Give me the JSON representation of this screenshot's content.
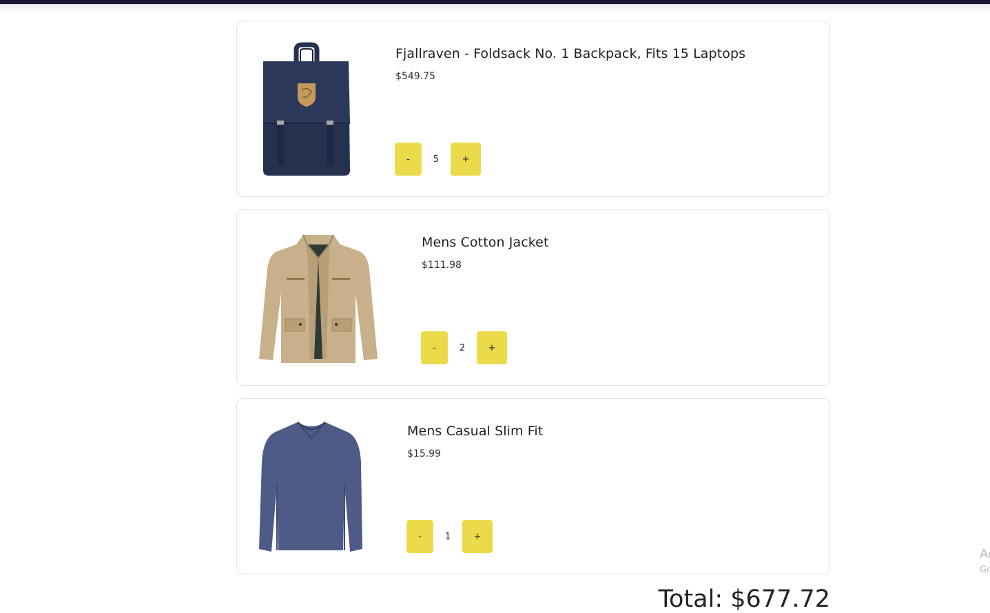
{
  "cart": {
    "items": [
      {
        "title": "Fjallraven - Foldsack No. 1 Backpack, Fits 15 Laptops",
        "price": "$549.75",
        "quantity": "5",
        "image_icon": "backpack-image",
        "image_color": "#26314f"
      },
      {
        "title": "Mens Cotton Jacket",
        "price": "$111.98",
        "quantity": "2",
        "image_icon": "jacket-image",
        "image_color": "#c8b08a"
      },
      {
        "title": "Mens Casual Slim Fit",
        "price": "$15.99",
        "quantity": "1",
        "image_icon": "tshirt-image",
        "image_color": "#4e5b87"
      }
    ],
    "decrement_label": "-",
    "increment_label": "+",
    "total": "Total: $677.72"
  },
  "edge_overlay": {
    "line1": "Ac",
    "line2": "Go"
  },
  "colors": {
    "accent": "#ebdb4a",
    "topbar": "#1a1530",
    "card_border": "#e4e4e4"
  }
}
